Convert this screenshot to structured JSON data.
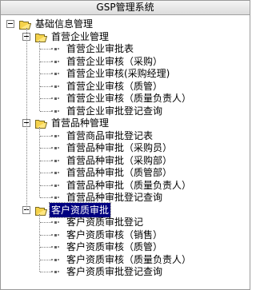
{
  "window": {
    "title": "GSP管理系统"
  },
  "tree": {
    "root_label": "基础信息管理",
    "groups": [
      {
        "label": "首营企业管理",
        "items": [
          "首营企业审批表",
          "首营企业审核（采购）",
          "首营企业审核(采购经理)",
          "首营企业审核（质管）",
          "首营企业审核（质量负责人）",
          "首营企业审批登记查询"
        ]
      },
      {
        "label": "首营品种管理",
        "items": [
          "首营商品审批登记表",
          "首营品种审批（采购员）",
          "首营品种审批（采购部）",
          "首营品种审批（质管部）",
          "首营品种审批（质量负责人）",
          "首营品种审批登记查询"
        ]
      },
      {
        "label": "客户资质审批",
        "selected": true,
        "items": [
          "客户资质审批登记",
          "客户资质审核（销售）",
          "客户资质审核（质管）",
          "客户资质审核（质量负责人）",
          "客户资质审批登记查询"
        ]
      }
    ]
  }
}
